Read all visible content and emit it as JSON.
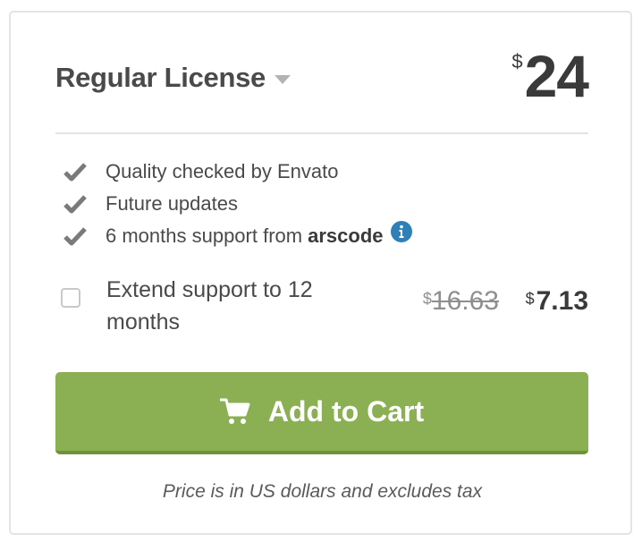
{
  "license": {
    "name": "Regular License",
    "currency_symbol": "$",
    "price": "24"
  },
  "features": [
    {
      "text": "Quality checked by Envato"
    },
    {
      "text": "Future updates"
    },
    {
      "text": "6 months support from",
      "author": "arscode"
    }
  ],
  "extend_support": {
    "label": "Extend support to 12 months",
    "checked": false,
    "old_currency": "$",
    "old_price": "16.63",
    "new_currency": "$",
    "new_price": "7.13"
  },
  "cart_button": {
    "label": "Add to Cart",
    "icon": "cart-icon"
  },
  "footnote": "Price is in US dollars and excludes tax",
  "colors": {
    "button_green": "#8bb054",
    "info_blue": "#2f80b8",
    "text_dark": "#4a4a4a"
  }
}
